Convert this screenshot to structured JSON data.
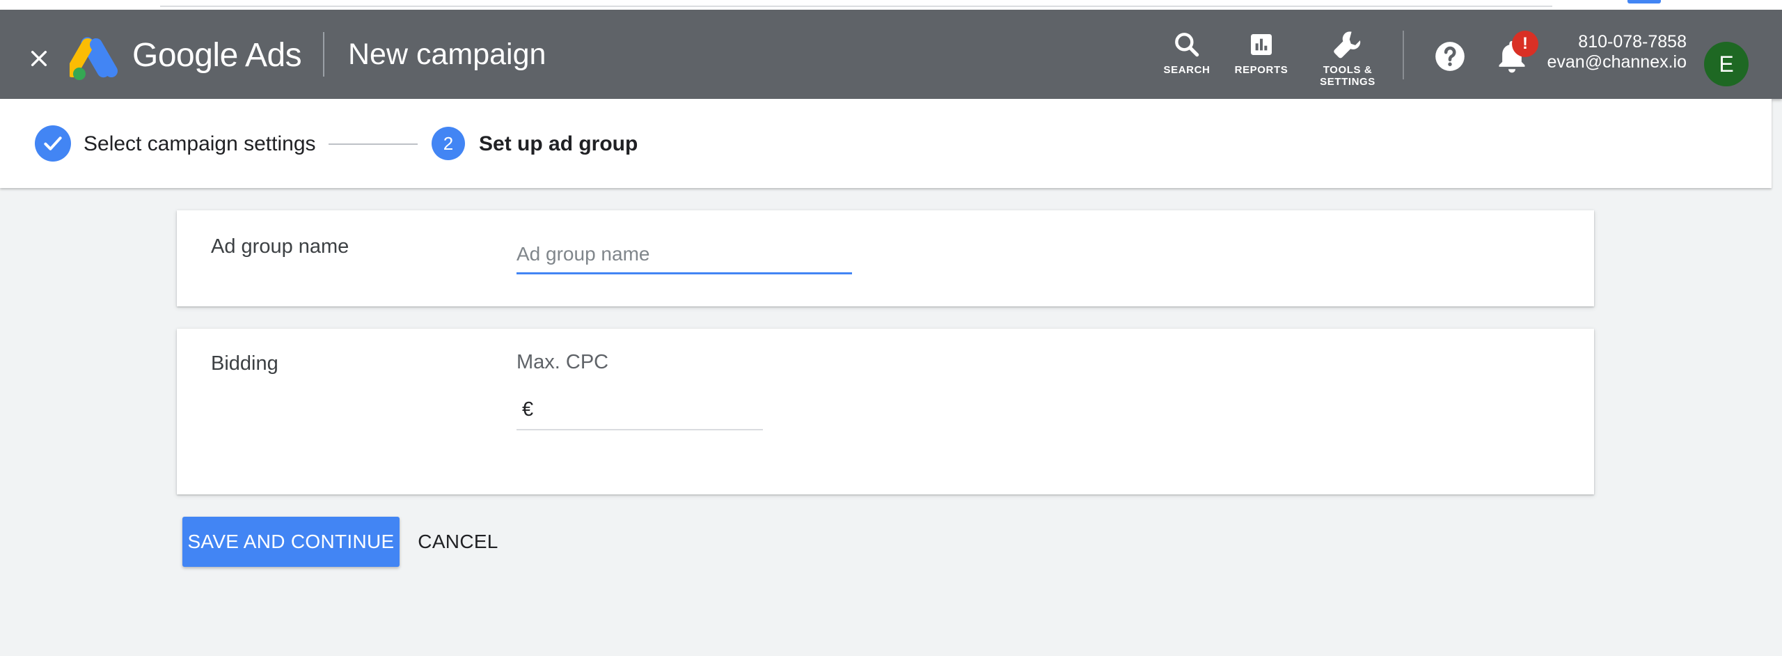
{
  "header": {
    "brand": "Google Ads",
    "title": "New campaign",
    "tools": [
      {
        "label": "SEARCH",
        "icon": "search-icon"
      },
      {
        "label": "REPORTS",
        "icon": "bar-chart-icon"
      },
      {
        "label": "TOOLS & SETTINGS",
        "icon": "wrench-icon"
      }
    ],
    "notification_badge": "!",
    "account": {
      "phone": "810-078-7858",
      "email": "evan@channex.io",
      "avatar_letter": "E"
    }
  },
  "stepper": {
    "steps": [
      {
        "label": "Select campaign settings",
        "status": "completed"
      },
      {
        "number": "2",
        "label": "Set up ad group",
        "status": "current"
      }
    ]
  },
  "form": {
    "ad_group": {
      "label": "Ad group name",
      "placeholder": "Ad group name",
      "value": ""
    },
    "bidding": {
      "label": "Bidding",
      "sublabel": "Max. CPC",
      "currency": "€",
      "value": ""
    }
  },
  "actions": {
    "save": "SAVE AND CONTINUE",
    "cancel": "CANCEL"
  },
  "colors": {
    "header_bg": "#5f6368",
    "accent": "#4285f4",
    "badge": "#d93025",
    "avatar_bg": "#1e6823",
    "page_bg": "#f1f3f4"
  }
}
